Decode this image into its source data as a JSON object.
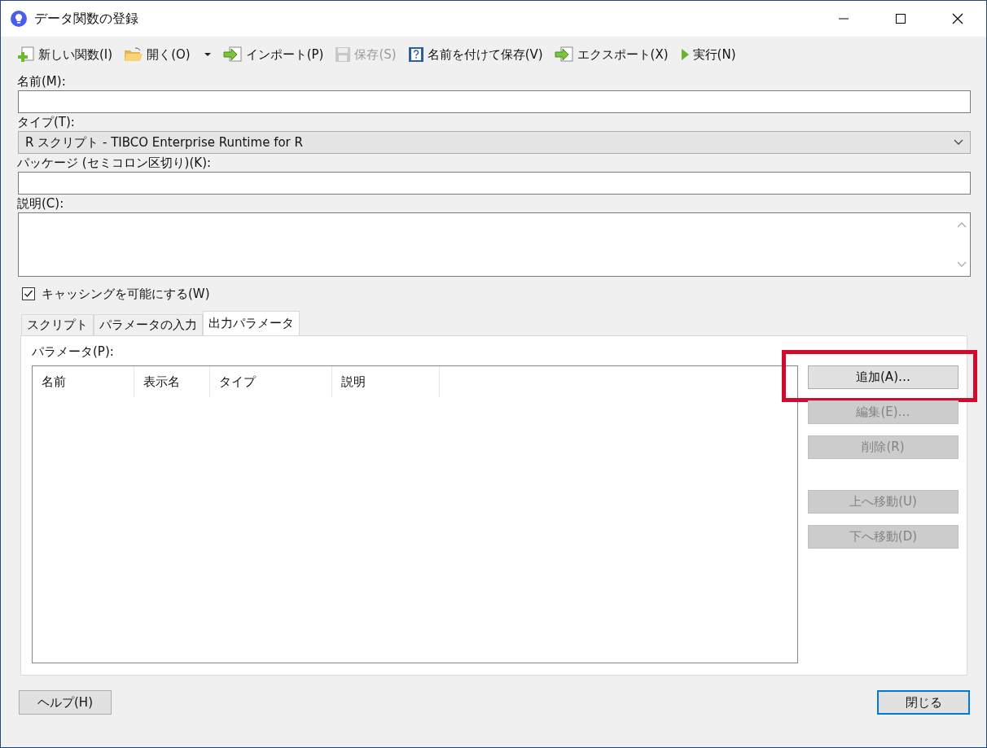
{
  "window": {
    "title": "データ関数の登録"
  },
  "toolbar": [
    {
      "kind": "new",
      "label": "新しい関数(I)",
      "disabled": false,
      "dropdown": false
    },
    {
      "kind": "open",
      "label": "開く(O)",
      "disabled": false,
      "dropdown": true
    },
    {
      "kind": "import",
      "label": "インポート(P)",
      "disabled": false,
      "dropdown": false
    },
    {
      "kind": "save",
      "label": "保存(S)",
      "disabled": true,
      "dropdown": false
    },
    {
      "kind": "saveas",
      "label": "名前を付けて保存(V)",
      "disabled": false,
      "dropdown": false
    },
    {
      "kind": "export",
      "label": "エクスポート(X)",
      "disabled": false,
      "dropdown": false
    },
    {
      "kind": "run",
      "label": "実行(N)",
      "disabled": false,
      "dropdown": false
    }
  ],
  "name_field": {
    "label": "名前(M):"
  },
  "type_field": {
    "label": "タイプ(T):",
    "value": "R スクリプト - TIBCO Enterprise Runtime for R"
  },
  "packages_field": {
    "label": "パッケージ (セミコロン区切り)(K):"
  },
  "description_field": {
    "label": "説明(C):"
  },
  "caching": {
    "label": "キャッシングを可能にする(W)",
    "checked": true
  },
  "tabs": [
    {
      "label": "スクリプト",
      "selected": false
    },
    {
      "label": "パラメータの入力",
      "selected": false
    },
    {
      "label": "出力パラメータ",
      "selected": true
    }
  ],
  "parameters": {
    "label": "パラメータ(P):",
    "columns": [
      "名前",
      "表示名",
      "タイプ",
      "説明"
    ]
  },
  "side_buttons": [
    {
      "label": "追加(A)…",
      "disabled": false,
      "highlighted": true
    },
    {
      "label": "編集(E)…",
      "disabled": true,
      "highlighted": false
    },
    {
      "label": "削除(R)",
      "disabled": true,
      "highlighted": false
    },
    {
      "label": "上へ移動(U)",
      "disabled": true,
      "highlighted": false
    },
    {
      "label": "下へ移動(D)",
      "disabled": true,
      "highlighted": false
    }
  ],
  "footer": [
    {
      "label": "ヘルプ(H)",
      "default": false
    },
    {
      "label": "閉じる",
      "default": true
    }
  ]
}
